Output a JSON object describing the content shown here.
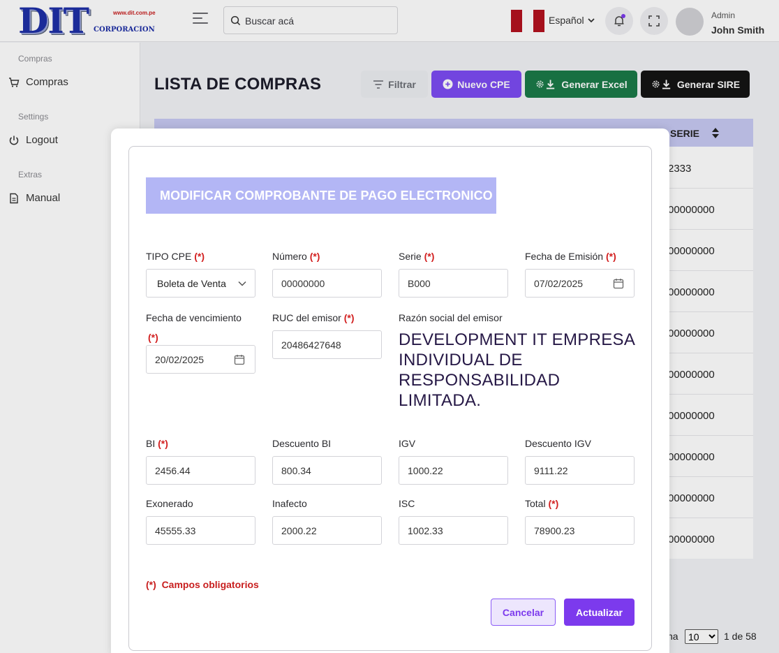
{
  "header": {
    "logo_text": "DIT",
    "logo_url": "www.dit.com.pe",
    "logo_corp": "CORPORACION",
    "search_placeholder": "Buscar acá",
    "language": "Español",
    "user_role": "Admin",
    "user_name": "John Smith",
    "flag_colors": [
      "#b3121f",
      "#ffffff",
      "#b3121f"
    ]
  },
  "sidebar": {
    "sections": [
      {
        "title": "Compras",
        "item": "Compras",
        "icon": "cart-icon"
      },
      {
        "title": "Settings",
        "item": "Logout",
        "icon": "power-icon"
      },
      {
        "title": "Extras",
        "item": "Manual",
        "icon": "document-icon"
      }
    ]
  },
  "main": {
    "title": "LISTA DE COMPRAS",
    "buttons": {
      "filter": "Filtrar",
      "new": "Nuevo CPE",
      "excel": "Generar Excel",
      "sire": "Generar SIRE"
    },
    "table": {
      "col_serie": "SERIE",
      "rows": [
        "2333",
        "00000000",
        "00000000",
        "00000000",
        "00000000",
        "00000000",
        "00000000",
        "00000000",
        "00000000",
        "00000000"
      ]
    },
    "pagination": {
      "label_partial": "na",
      "page_size": "10",
      "of_text": "1 de 58"
    }
  },
  "modal": {
    "title": "MODIFICAR COMPROBANTE DE PAGO ELECTRONICO",
    "required_mark": "(*)",
    "fields": {
      "tipo_cpe": {
        "label": "TIPO CPE",
        "value": "Boleta de Venta"
      },
      "numero": {
        "label": "Número",
        "value": "00000000"
      },
      "serie": {
        "label": "Serie",
        "value": "B000"
      },
      "fecha_emision": {
        "label": "Fecha de Emisión",
        "value": "07/02/2025"
      },
      "fecha_vencimiento": {
        "label": "Fecha de vencimiento",
        "value": "20/02/2025"
      },
      "ruc_emisor": {
        "label": "RUC del emisor",
        "value": "20486427648"
      },
      "razon_social": {
        "label": "Razón social del emisor",
        "value": "DEVELOPMENT IT EMPRESA INDIVIDUAL DE RESPONSABILIDAD LIMITADA."
      },
      "bi": {
        "label": "BI",
        "value": "2456.44"
      },
      "descuento_bi": {
        "label": "Descuento BI",
        "value": "800.34"
      },
      "igv": {
        "label": "IGV",
        "value": "1000.22"
      },
      "descuento_igv": {
        "label": "Descuento IGV",
        "value": "9111.22"
      },
      "exonerado": {
        "label": "Exonerado",
        "value": "45555.33"
      },
      "inafecto": {
        "label": "Inafecto",
        "value": "2000.22"
      },
      "isc": {
        "label": "ISC",
        "value": "1002.33"
      },
      "total": {
        "label": "Total",
        "value": "78900.23"
      }
    },
    "required_note_mark": "(*)",
    "required_note": "Campos obligatorios",
    "cancel": "Cancelar",
    "update": "Actualizar"
  },
  "colors": {
    "primary": "#7c3aed",
    "excel": "#1b7a48",
    "sire": "#141414",
    "banner": "#b3b6f5",
    "required": "#d21f1f"
  }
}
